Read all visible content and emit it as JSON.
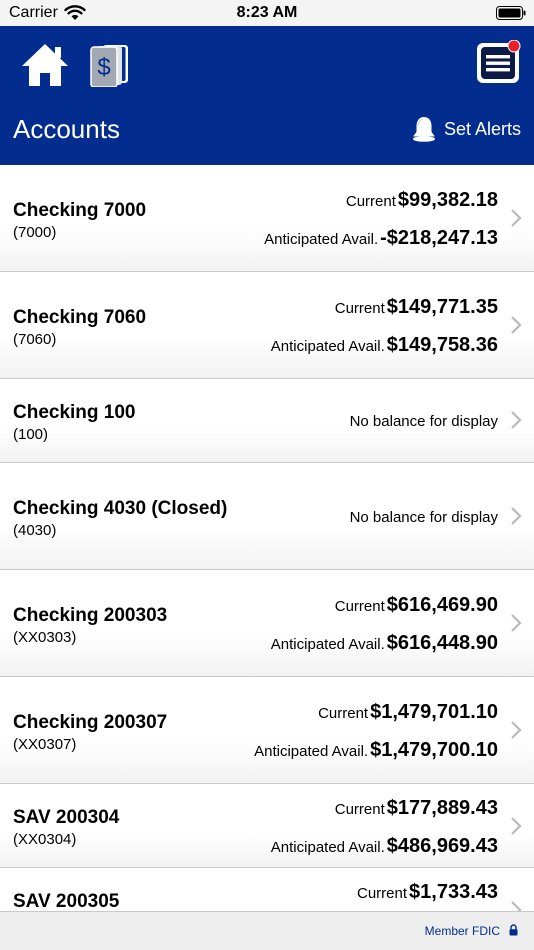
{
  "status_bar": {
    "carrier": "Carrier",
    "time": "8:23 AM"
  },
  "header": {
    "title": "Accounts",
    "alerts_label": "Set Alerts"
  },
  "accounts": [
    {
      "name": "Checking 7000",
      "number": "(7000)",
      "current_label": "Current",
      "current": "$99,382.18",
      "anticipated_label": "Anticipated Avail.",
      "anticipated": "-$218,247.13"
    },
    {
      "name": "Checking 7060",
      "number": "(7060)",
      "current_label": "Current",
      "current": "$149,771.35",
      "anticipated_label": "Anticipated Avail.",
      "anticipated": "$149,758.36"
    },
    {
      "name": "Checking 100",
      "number": "(100)",
      "no_balance": "No balance for display"
    },
    {
      "name": "Checking 4030 (Closed)",
      "number": "(4030)",
      "no_balance": "No balance for display"
    },
    {
      "name": "Checking 200303",
      "number": "(XX0303)",
      "current_label": "Current",
      "current": "$616,469.90",
      "anticipated_label": "Anticipated Avail.",
      "anticipated": "$616,448.90"
    },
    {
      "name": "Checking 200307",
      "number": "(XX0307)",
      "current_label": "Current",
      "current": "$1,479,701.10",
      "anticipated_label": "Anticipated Avail.",
      "anticipated": "$1,479,700.10"
    },
    {
      "name": "SAV 200304",
      "number": "(XX0304)",
      "current_label": "Current",
      "current": "$177,889.43",
      "anticipated_label": "Anticipated Avail.",
      "anticipated": "$486,969.43"
    },
    {
      "name": "SAV 200305",
      "current_label": "Current",
      "current": "$1,733.43"
    }
  ],
  "footer": {
    "fdic": "Member FDIC"
  },
  "icons": {
    "home": "home-icon",
    "dollar": "dollar-cards-icon",
    "menu": "hamburger-menu-icon",
    "bell": "bell-icon",
    "chevron": "chevron-right-icon",
    "lock": "lock-icon"
  },
  "colors": {
    "brand": "#022d8f",
    "badge": "#e8202a"
  }
}
